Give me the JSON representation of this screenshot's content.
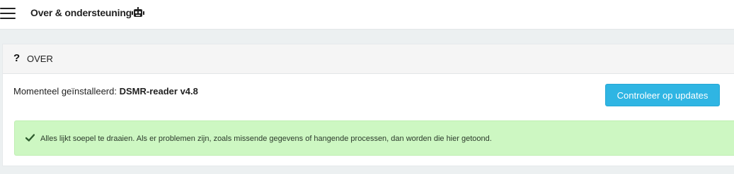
{
  "header": {
    "menu_icon": "hamburger-menu-icon",
    "title": "Over & ondersteuning",
    "title_icon": "robot-icon"
  },
  "about_panel": {
    "header_icon": "question-icon",
    "header_icon_glyph": "?",
    "title": "OVER",
    "installed_label": "Momenteel geïnstalleerd:",
    "installed_version": "DSMR-reader v4.8",
    "check_updates_label": "Controleer op updates",
    "status_message": {
      "icon": "check-icon",
      "text": "Alles lijkt soepel te draaien. Als er problemen zijn, zoals missende gegevens of hangende processen, dan worden die hier getoond."
    }
  },
  "colors": {
    "accent_button": "#2fb5e3",
    "success_background": "#cdf7c2",
    "page_background": "#ecf0f1"
  }
}
